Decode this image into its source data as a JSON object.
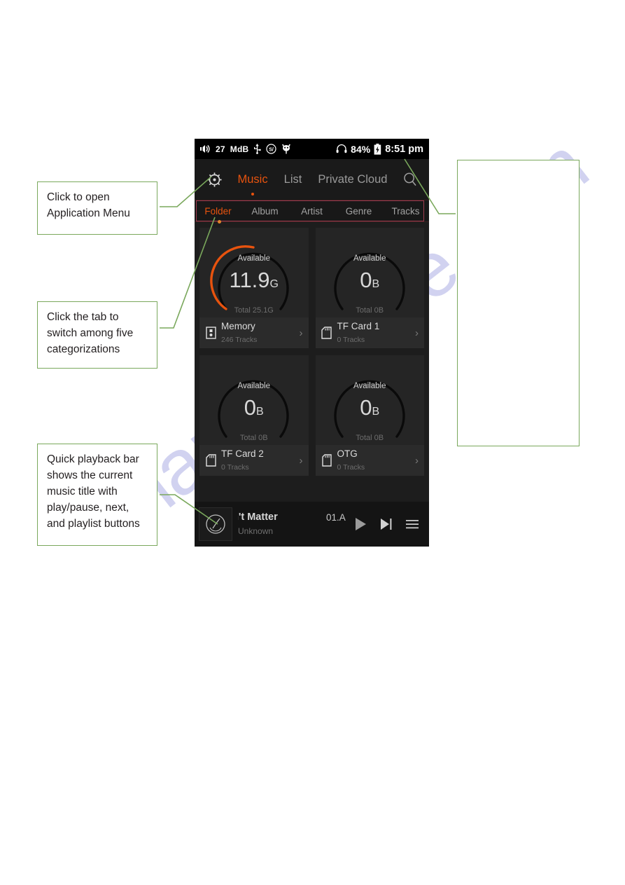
{
  "page": {
    "watermark": "manualshive.com"
  },
  "callouts": [
    {
      "id": "menu",
      "text": "Click to open Application Menu"
    },
    {
      "id": "tabs",
      "text": "Click the tab to switch among five categorizations"
    },
    {
      "id": "player",
      "text": "Quick playback bar shows the current music title with play/pause, next, and playlist buttons"
    },
    {
      "id": "blank",
      "text": ""
    }
  ],
  "colors": {
    "accent": "#e8530e",
    "callout_border": "#7aa85c",
    "highlight_box": "#9e3b4f",
    "watermark": "#c9cbee",
    "screen_bg": "#1d1d1d"
  },
  "device": {
    "statusbar": {
      "volume_icon": "speaker-icon",
      "volume_value": "27",
      "volume_unit": "MdB",
      "usb_icon": "usb-icon",
      "sq_icon": "sq-circle-icon",
      "bluetooth_icon": "owl-icon",
      "headphone_icon": "headphone-icon",
      "battery_percent": "84%",
      "battery_icon": "battery-charging-icon",
      "time": "8:51 pm"
    },
    "topnav": {
      "menu_icon": "gear-icon",
      "search_icon": "search-icon",
      "items": [
        {
          "label": "Music",
          "active": true
        },
        {
          "label": "List",
          "active": false
        },
        {
          "label": "Private Cloud",
          "active": false
        }
      ]
    },
    "tabs": [
      {
        "label": "Folder",
        "active": true
      },
      {
        "label": "Album",
        "active": false
      },
      {
        "label": "Artist",
        "active": false
      },
      {
        "label": "Genre",
        "active": false
      },
      {
        "label": "Tracks",
        "active": false
      }
    ],
    "storage_cards": [
      {
        "available_label": "Available",
        "value": "11.9",
        "unit": "G",
        "total": "Total 25.1G",
        "name": "Memory",
        "tracks": "246 Tracks",
        "icon": "internal-memory-icon",
        "percent": 47,
        "arc_color": "#e8530e"
      },
      {
        "available_label": "Available",
        "value": "0",
        "unit": "B",
        "total": "Total 0B",
        "name": "TF Card 1",
        "tracks": "0 Tracks",
        "icon": "sd-card-icon",
        "percent": 0,
        "arc_color": "#000000"
      },
      {
        "available_label": "Available",
        "value": "0",
        "unit": "B",
        "total": "Total 0B",
        "name": "TF Card 2",
        "tracks": "0 Tracks",
        "icon": "sd-card-icon",
        "percent": 0,
        "arc_color": "#000000"
      },
      {
        "available_label": "Available",
        "value": "0",
        "unit": "B",
        "total": "Total 0B",
        "name": "OTG",
        "tracks": "0 Tracks",
        "icon": "otg-icon",
        "percent": 0,
        "arc_color": "#000000"
      }
    ],
    "player": {
      "album_art_icon": "gauge-disc-icon",
      "title": "sn't Matter",
      "artist": "Unknown",
      "file": "01.A",
      "play_icon": "play-icon",
      "next_icon": "next-track-icon",
      "playlist_icon": "playlist-icon"
    }
  }
}
